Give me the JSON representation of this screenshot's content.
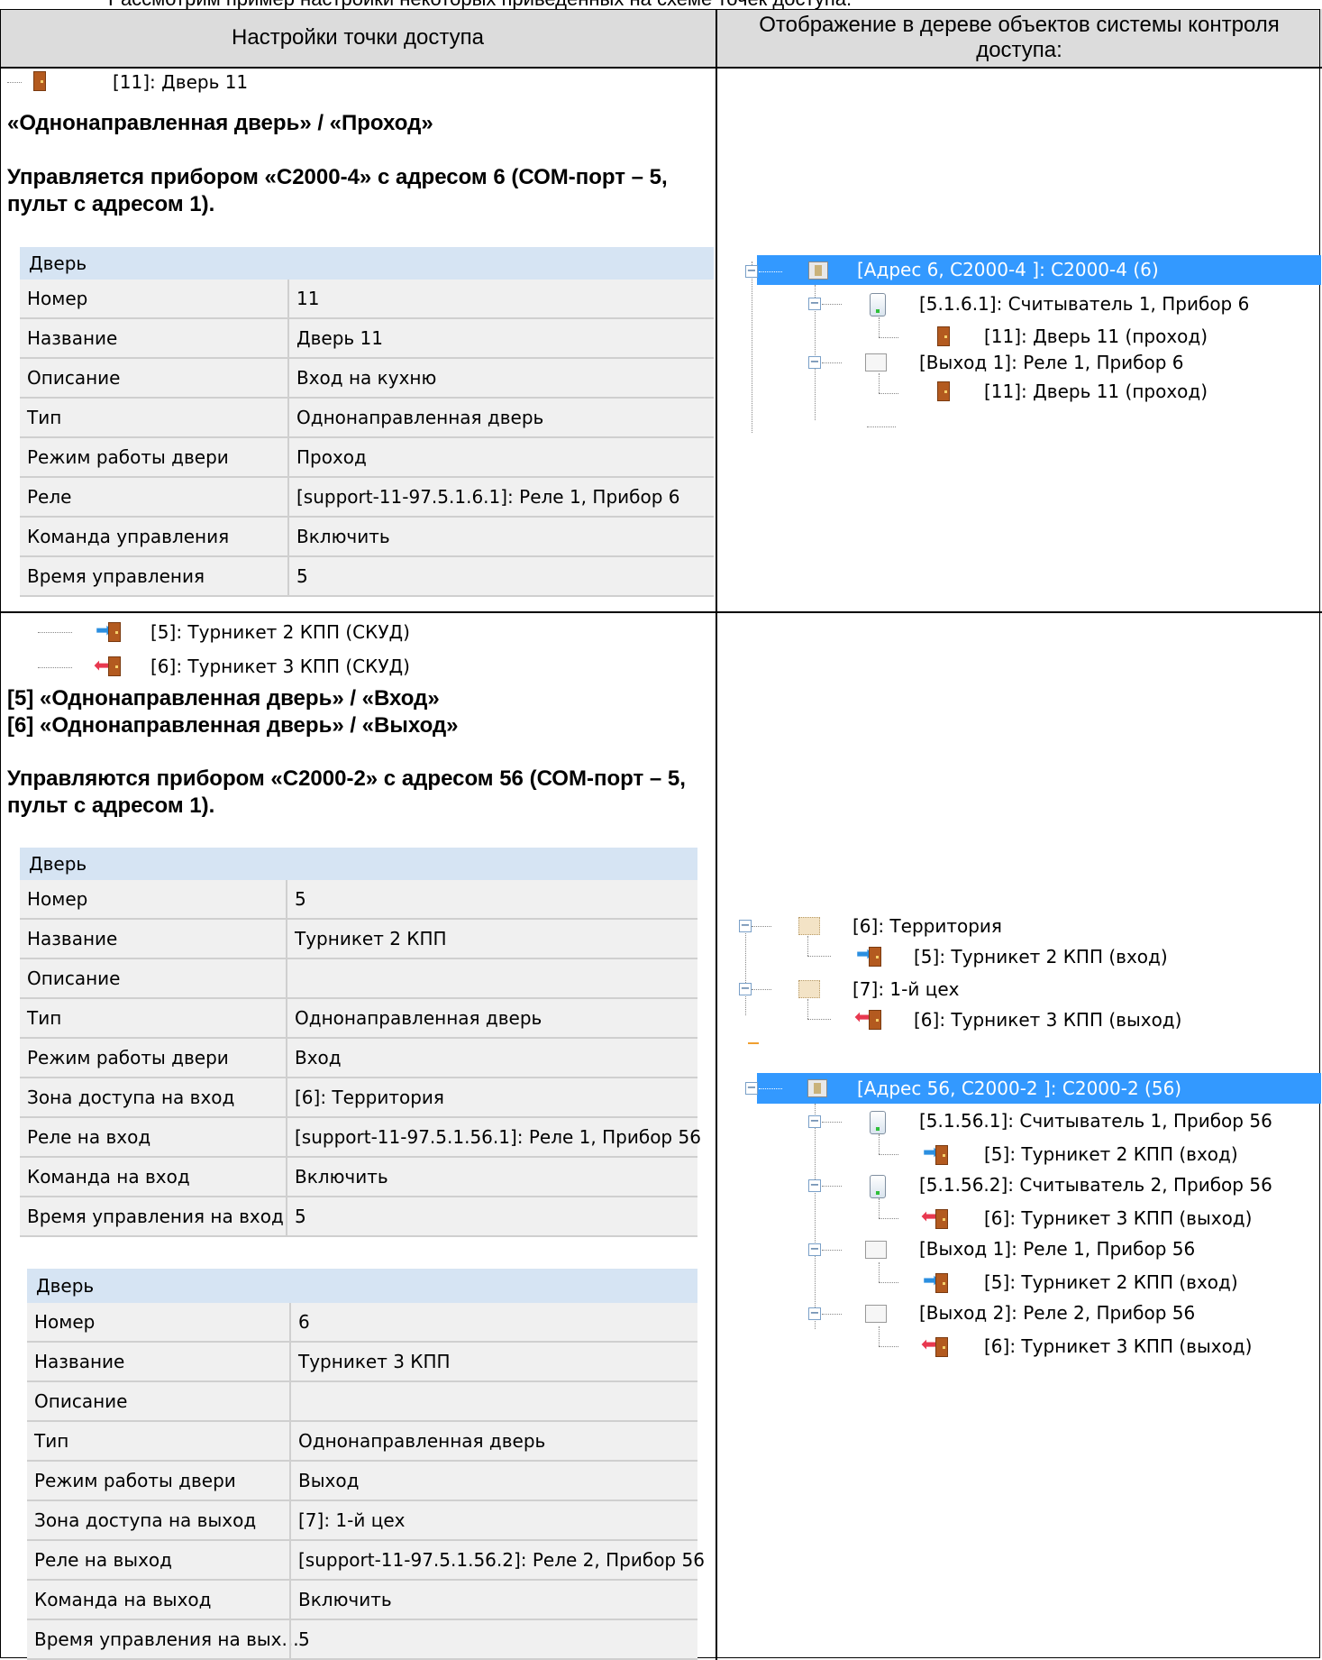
{
  "top_cut_text": "Рассмотрим пример настройки некоторых приведенных на схеме точек доступа.",
  "headers": {
    "col1": "Настройки точки доступа",
    "col2": "Отображение в дереве объектов системы контроля доступа:"
  },
  "section1": {
    "tree_item": "[11]: Дверь 11",
    "mode": "«Однонаправленная дверь» / «Проход»",
    "control": "Управляется прибором «С2000-4» с адресом 6 (СОМ-порт – 5, пульт с адресом 1).",
    "panel": {
      "title": "Дверь",
      "rows": [
        {
          "k": "Номер",
          "v": "11"
        },
        {
          "k": "Название",
          "v": "Дверь 11"
        },
        {
          "k": "Описание",
          "v": "Вход на кухню"
        },
        {
          "k": "Тип",
          "v": "Однонаправленная дверь"
        },
        {
          "k": "Режим работы двери",
          "v": "Проход"
        },
        {
          "k": "Реле",
          "v": "[support-11-97.5.1.6.1]: Реле 1, Прибор 6"
        },
        {
          "k": "Команда управления",
          "v": "Включить"
        },
        {
          "k": "Время управления",
          "v": "5"
        }
      ]
    },
    "tree": {
      "device": "[Адрес 6, С2000-4 ]: С2000-4 (6)",
      "reader": "[5.1.6.1]: Считыватель 1, Прибор 6",
      "door_a": "[11]: Дверь 11 (проход)",
      "relay": "[Выход 1]: Реле 1, Прибор 6",
      "door_b": "[11]: Дверь 11 (проход)"
    }
  },
  "section2": {
    "tree_item_5": "[5]: Турникет 2 КПП (СКУД)",
    "tree_item_6": "[6]: Турникет 3 КПП (СКУД)",
    "mode_5": "[5] «Однонаправленная дверь» / «Вход»",
    "mode_6": "[6] «Однонаправленная дверь» / «Выход»",
    "control": "Управляются прибором «С2000-2» с адресом 56 (СОМ-порт – 5, пульт с адресом 1).",
    "panel_a": {
      "title": "Дверь",
      "rows": [
        {
          "k": "Номер",
          "v": "5"
        },
        {
          "k": "Название",
          "v": "Турникет 2 КПП"
        },
        {
          "k": "Описание",
          "v": ""
        },
        {
          "k": "Тип",
          "v": "Однонаправленная дверь"
        },
        {
          "k": "Режим работы двери",
          "v": "Вход"
        },
        {
          "k": "Зона доступа на вход",
          "v": "[6]: Территория"
        },
        {
          "k": "Реле на вход",
          "v": "[support-11-97.5.1.56.1]: Реле 1, Прибор 56"
        },
        {
          "k": "Команда на вход",
          "v": "Включить"
        },
        {
          "k": "Время управления на вход",
          "v": "5"
        }
      ]
    },
    "panel_b": {
      "title": "Дверь",
      "rows": [
        {
          "k": "Номер",
          "v": "6"
        },
        {
          "k": "Название",
          "v": "Турникет 3 КПП"
        },
        {
          "k": "Описание",
          "v": ""
        },
        {
          "k": "Тип",
          "v": "Однонаправленная дверь"
        },
        {
          "k": "Режим работы двери",
          "v": "Выход"
        },
        {
          "k": "Зона доступа на выход",
          "v": "[7]: 1-й цех"
        },
        {
          "k": "Реле на выход",
          "v": "[support-11-97.5.1.56.2]: Реле 2, Прибор 56"
        },
        {
          "k": "Команда на выход",
          "v": "Включить"
        },
        {
          "k": "Время управления на вых...",
          "v": "5"
        }
      ]
    },
    "zones_tree": {
      "zone_6": "[6]: Территория",
      "turn_2": "[5]: Турникет 2 КПП (вход)",
      "zone_7": "[7]: 1-й цех",
      "turn_3": "[6]: Турникет 3 КПП (выход)"
    },
    "device_tree": {
      "device": "[Адрес 56, С2000-2 ]: С2000-2 (56)",
      "reader1": "[5.1.56.1]: Считыватель 1, Прибор 56",
      "r1_door": "[5]: Турникет 2 КПП (вход)",
      "reader2": "[5.1.56.2]: Считыватель 2, Прибор 56",
      "r2_door": "[6]: Турникет 3 КПП (выход)",
      "relay1": "[Выход 1]: Реле 1, Прибор 56",
      "rl1_door": "[5]: Турникет 2 КПП (вход)",
      "relay2": "[Выход 2]: Реле 2, Прибор 56",
      "rl2_door": "[6]: Турникет 3 КПП (выход)"
    }
  },
  "colors": {
    "header_bg": "#dcdcdc",
    "panel_title_bg": "#d6e4f3",
    "panel_row_bg": "#f0f0f0",
    "selection": "#3399ff"
  }
}
